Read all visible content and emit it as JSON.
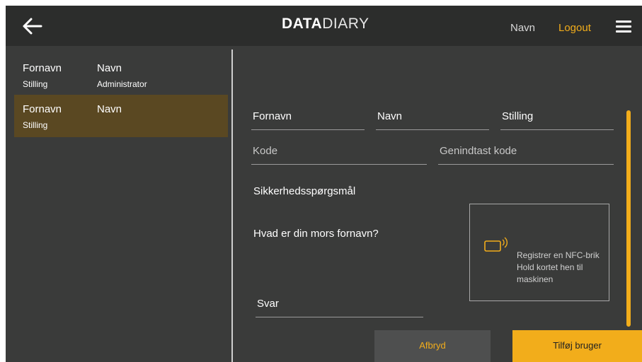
{
  "header": {
    "logo_bold": "DATA",
    "logo_light": "DIARY",
    "user_name": "Navn",
    "logout_label": "Logout"
  },
  "icons": {
    "back": "arrow-left-icon",
    "menu": "hamburger-menu-icon",
    "nfc": "nfc-card-icon"
  },
  "colors": {
    "accent": "#f2ad1b",
    "panel": "#3a3b3a",
    "topbar": "#2c2d2c",
    "selected_row": "#5a4822"
  },
  "user_list": [
    {
      "first_name": "Fornavn",
      "last_name": "Navn",
      "position": "Stilling",
      "role": "Administrator",
      "selected": false
    },
    {
      "first_name": "Fornavn",
      "last_name": "Navn",
      "position": "Stilling",
      "role": "",
      "selected": true
    }
  ],
  "form": {
    "first_name": "Fornavn",
    "last_name": "Navn",
    "position": "Stilling",
    "code_placeholder": "Kode",
    "repeat_code_placeholder": "Genindtast kode",
    "security_question_label": "Sikkerhedsspørgsmål",
    "security_question": "Hvad er din mors fornavn?",
    "answer": "Svar"
  },
  "nfc": {
    "line1": "Registrer en NFC-brik",
    "line2": "Hold kortet hen til",
    "line3": "maskinen"
  },
  "actions": {
    "cancel_label": "Afbryd",
    "add_user_label": "Tilføj bruger"
  }
}
